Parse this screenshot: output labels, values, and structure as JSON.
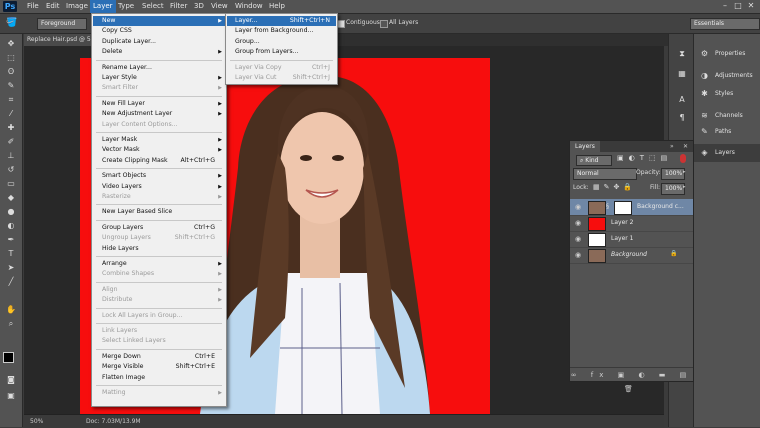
{
  "app": {
    "logo": "Ps"
  },
  "menubar": {
    "items": [
      "File",
      "Edit",
      "Image",
      "Layer",
      "Type",
      "Select",
      "Filter",
      "3D",
      "View",
      "Window",
      "Help"
    ]
  },
  "options": {
    "fill_source": "Foreground",
    "contiguous": "Contiguous",
    "all_layers": "All Layers",
    "workspace": "Essentials"
  },
  "document": {
    "tab_title": "Replace Hair.psd @ 50..."
  },
  "status": {
    "zoom": "50%",
    "doc_size": "Doc: 7.03M/13.9M"
  },
  "layer_menu": {
    "items": [
      {
        "label": "New",
        "arrow": true,
        "hl": true
      },
      {
        "label": "Copy CSS"
      },
      {
        "label": "Duplicate Layer..."
      },
      {
        "label": "Delete",
        "arrow": true
      },
      {
        "sep": true
      },
      {
        "label": "Rename Layer..."
      },
      {
        "label": "Layer Style",
        "arrow": true
      },
      {
        "label": "Smart Filter",
        "arrow": true,
        "dis": true
      },
      {
        "sep": true
      },
      {
        "label": "New Fill Layer",
        "arrow": true
      },
      {
        "label": "New Adjustment Layer",
        "arrow": true
      },
      {
        "label": "Layer Content Options...",
        "dis": true
      },
      {
        "sep": true
      },
      {
        "label": "Layer Mask",
        "arrow": true
      },
      {
        "label": "Vector Mask",
        "arrow": true
      },
      {
        "label": "Create Clipping Mask",
        "shortcut": "Alt+Ctrl+G"
      },
      {
        "sep": true
      },
      {
        "label": "Smart Objects",
        "arrow": true
      },
      {
        "label": "Video Layers",
        "arrow": true
      },
      {
        "label": "Rasterize",
        "arrow": true,
        "dis": true
      },
      {
        "sep": true
      },
      {
        "label": "New Layer Based Slice"
      },
      {
        "sep": true
      },
      {
        "label": "Group Layers",
        "shortcut": "Ctrl+G"
      },
      {
        "label": "Ungroup Layers",
        "shortcut": "Shift+Ctrl+G",
        "dis": true
      },
      {
        "label": "Hide Layers"
      },
      {
        "sep": true
      },
      {
        "label": "Arrange",
        "arrow": true
      },
      {
        "label": "Combine Shapes",
        "arrow": true,
        "dis": true
      },
      {
        "sep": true
      },
      {
        "label": "Align",
        "arrow": true,
        "dis": true
      },
      {
        "label": "Distribute",
        "arrow": true,
        "dis": true
      },
      {
        "sep": true
      },
      {
        "label": "Lock All Layers in Group...",
        "dis": true
      },
      {
        "sep": true
      },
      {
        "label": "Link Layers",
        "dis": true
      },
      {
        "label": "Select Linked Layers",
        "dis": true
      },
      {
        "sep": true
      },
      {
        "label": "Merge Down",
        "shortcut": "Ctrl+E"
      },
      {
        "label": "Merge Visible",
        "shortcut": "Shift+Ctrl+E"
      },
      {
        "label": "Flatten Image"
      },
      {
        "sep": true
      },
      {
        "label": "Matting",
        "arrow": true,
        "dis": true
      }
    ]
  },
  "new_submenu": {
    "items": [
      {
        "label": "Layer...",
        "shortcut": "Shift+Ctrl+N",
        "hl": true
      },
      {
        "label": "Layer from Background..."
      },
      {
        "label": "Group..."
      },
      {
        "label": "Group from Layers..."
      },
      {
        "sep": true
      },
      {
        "label": "Layer Via Copy",
        "shortcut": "Ctrl+J",
        "dis": true
      },
      {
        "label": "Layer Via Cut",
        "shortcut": "Shift+Ctrl+J",
        "dis": true
      }
    ]
  },
  "dock": {
    "items": [
      "Properties",
      "Adjustments",
      "Styles",
      "Channels",
      "Paths",
      "Layers"
    ]
  },
  "layers": {
    "tab": "Layers",
    "filter": "Kind",
    "blend_mode": "Normal",
    "opacity_label": "Opacity:",
    "opacity": "100%",
    "lock_label": "Lock:",
    "fill_label": "Fill:",
    "fill": "100%",
    "rows": [
      {
        "name": "Background c...",
        "thumb": "photo",
        "selected": true,
        "mask": true
      },
      {
        "name": "Layer 2",
        "thumb": "red"
      },
      {
        "name": "Layer 1",
        "thumb": "white"
      },
      {
        "name": "Background",
        "thumb": "photo",
        "italic": true,
        "locked": true
      }
    ]
  },
  "colors": {
    "accent": "#2b6fb6",
    "canvas_red": "#f70d0d"
  }
}
